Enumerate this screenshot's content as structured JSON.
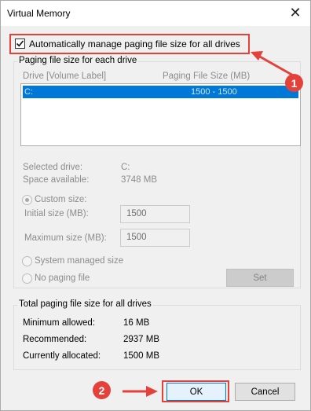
{
  "window": {
    "title": "Virtual Memory",
    "close_glyph": "✕"
  },
  "auto_manage": {
    "label": "Automatically manage paging file size for all drives",
    "checked": true
  },
  "per_drive": {
    "legend": "Paging file size for each drive",
    "col_drive": "Drive  [Volume Label]",
    "col_size": "Paging File Size (MB)",
    "rows": [
      {
        "drive": "C:",
        "size": "1500 - 1500"
      }
    ]
  },
  "selected": {
    "drive_label": "Selected drive:",
    "drive_value": "C:",
    "space_label": "Space available:",
    "space_value": "3748 MB"
  },
  "custom": {
    "label": "Custom size:",
    "initial_label": "Initial size (MB):",
    "initial_value": "1500",
    "max_label": "Maximum size (MB):",
    "max_value": "1500"
  },
  "system_managed_label": "System managed size",
  "no_paging_label": "No paging file",
  "set_button": "Set",
  "totals": {
    "legend": "Total paging file size for all drives",
    "min_label": "Minimum allowed:",
    "min_value": "16 MB",
    "rec_label": "Recommended:",
    "rec_value": "2937 MB",
    "cur_label": "Currently allocated:",
    "cur_value": "1500 MB"
  },
  "ok_button": "OK",
  "cancel_button": "Cancel",
  "annotations": {
    "step1": "1",
    "step2": "2",
    "color": "#e5413b"
  }
}
